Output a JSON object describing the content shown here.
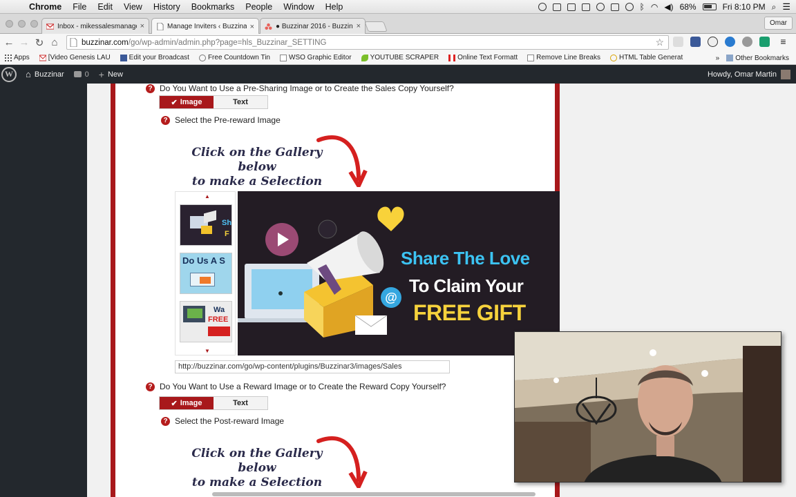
{
  "menubar": {
    "app_name": "Chrome",
    "items": [
      "File",
      "Edit",
      "View",
      "History",
      "Bookmarks",
      "People",
      "Window",
      "Help"
    ],
    "battery": "68%",
    "clock": "Fri 8:10 PM"
  },
  "tabs": [
    {
      "label": "Inbox - mikessalesmanage",
      "icon": "gmail-icon"
    },
    {
      "label": "Manage Inviters ‹ Buzzinar",
      "icon": "page-icon"
    },
    {
      "label": "● Buzzinar 2016 - Buzzina",
      "icon": "asana-icon"
    }
  ],
  "profile_name": "Omar",
  "address": {
    "host": "buzzinar.com",
    "path": "/go/wp-admin/admin.php?page=hls_Buzzinar_SETTING"
  },
  "bookmarks": [
    {
      "label": "Apps",
      "icon": "apps-icon"
    },
    {
      "label": "[Video Genesis LAU",
      "icon": "gmail-icon"
    },
    {
      "label": "Edit your Broadcast",
      "icon": "facebook-icon"
    },
    {
      "label": "Free Countdown Tin",
      "icon": "clock-icon"
    },
    {
      "label": "WSO Graphic Editor",
      "icon": "page-icon"
    },
    {
      "label": "YOUTUBE SCRAPER",
      "icon": "leaf-icon"
    },
    {
      "label": "Online Text Formatt",
      "icon": "flag-icon"
    },
    {
      "label": "Remove Line Breaks",
      "icon": "page-icon"
    },
    {
      "label": "HTML Table Generat",
      "icon": "g-icon"
    }
  ],
  "bookmarks_more": "»",
  "other_bookmarks": "Other Bookmarks",
  "wpbar": {
    "site_name": "Buzzinar",
    "comments": "0",
    "new_label": "New",
    "howdy": "Howdy, Omar Martin"
  },
  "form": {
    "q1": "Do You Want to Use a Pre-Sharing Image or to Create the Sales Copy Yourself?",
    "q2": "Do You Want to Use a Reward Image or to Create the Reward Copy Yourself?",
    "toggle_image": "Image",
    "toggle_text": "Text",
    "select_pre": "Select the Pre-reward Image",
    "select_post": "Select the Post-reward Image",
    "hint_line1": "Click on the Gallery below",
    "hint_line2": "to make a Selection",
    "image_url": "http://buzzinar.com/go/wp-content/plugins/Buzzinar3/images/Sales",
    "main_image": {
      "line1": "Share The Love",
      "line2": "To Claim Your",
      "line3": "FREE GIFT"
    },
    "thumbs": [
      {
        "text": "Sh",
        "sub": "F"
      },
      {
        "text": "Do Us A S",
        "sub": ""
      },
      {
        "text": "Wa",
        "sub": "FREE"
      }
    ]
  }
}
